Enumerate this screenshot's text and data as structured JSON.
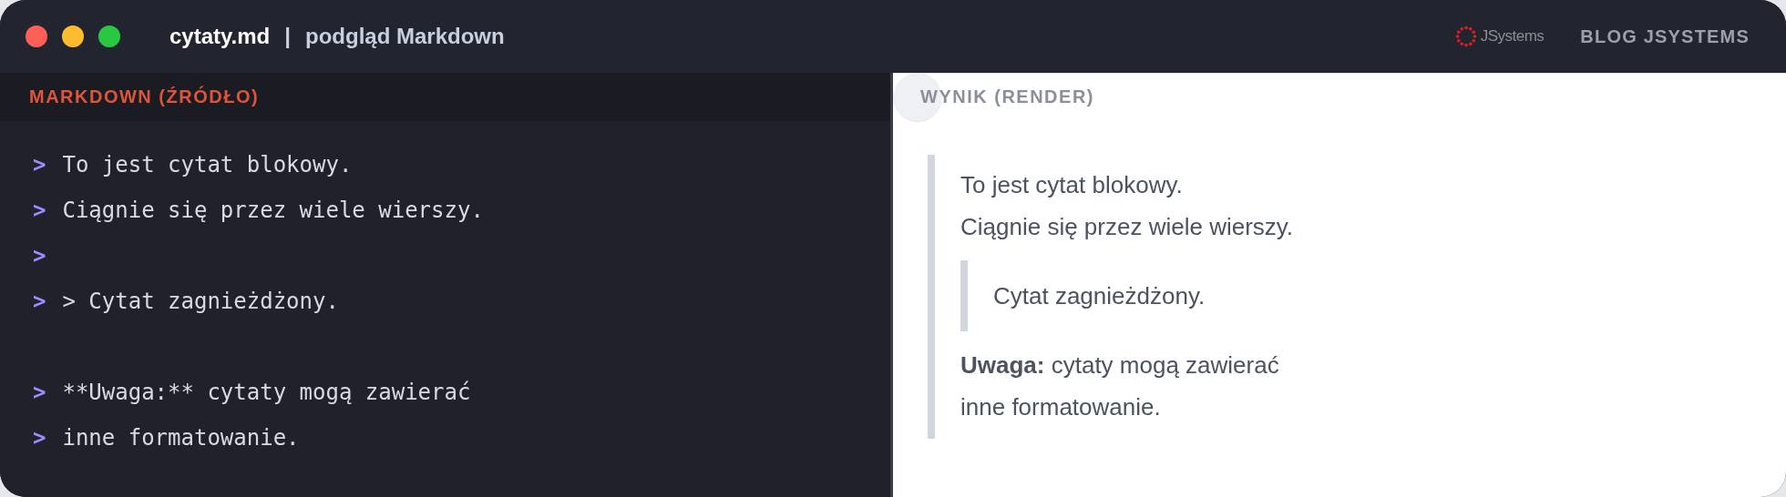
{
  "window": {
    "filename": "cytaty.md",
    "separator": "|",
    "subtitle": "podgląd Markdown",
    "brand": "BLOG JSYSTEMS",
    "logo_text": "JSystems",
    "traffic_lights": [
      {
        "color": "#ff5f57"
      },
      {
        "color": "#febc2e"
      },
      {
        "color": "#28c840"
      }
    ]
  },
  "source": {
    "header": "MARKDOWN (ŹRÓDŁO)",
    "lines": [
      {
        "kind": "quote",
        "marker": ">",
        "text": "To jest cytat blokowy."
      },
      {
        "kind": "quote",
        "marker": ">",
        "text": "Ciągnie się przez wiele wierszy."
      },
      {
        "kind": "quote",
        "marker": ">"
      },
      {
        "kind": "quote",
        "marker": ">",
        "text": "> Cytat zagnieżdżony."
      },
      {
        "kind": "blank"
      },
      {
        "kind": "quote",
        "marker": ">",
        "text": "**Uwaga:** cytaty mogą zawierać"
      },
      {
        "kind": "quote",
        "marker": ">",
        "text": "inne formatowanie."
      }
    ]
  },
  "render": {
    "header": "WYNIK (RENDER)",
    "blocks": [
      {
        "kind": "paragraph",
        "lines": [
          "To jest cytat blokowy.",
          "Ciągnie się przez wiele wierszy."
        ]
      },
      {
        "kind": "quote",
        "lines": [
          "Cytat zagnieżdżony."
        ]
      },
      {
        "kind": "paragraph",
        "lines": [
          "**Uwaga:** cytaty mogą zawierać",
          "inne formatowanie."
        ]
      }
    ]
  }
}
